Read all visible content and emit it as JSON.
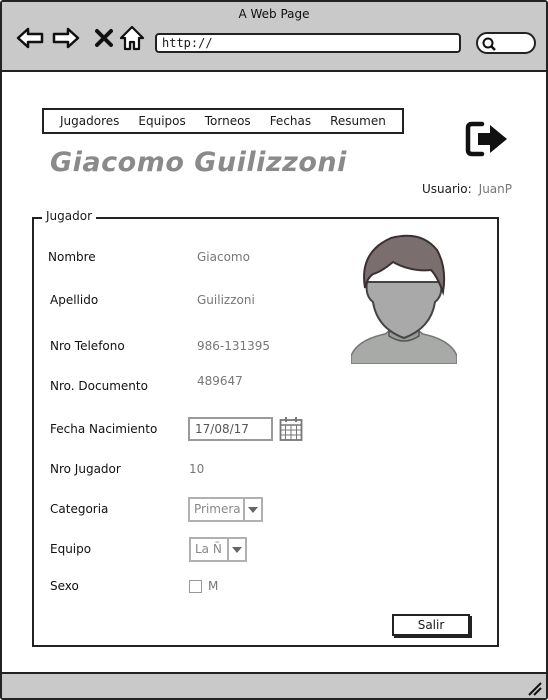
{
  "window": {
    "title": "A Web Page",
    "url": "http://"
  },
  "menu": {
    "items": [
      "Jugadores",
      "Equipos",
      "Torneos",
      "Fechas",
      "Resumen"
    ]
  },
  "header": {
    "title": "Giacomo Guilizzoni",
    "user_label": "Usuario:",
    "user_value": "JuanP"
  },
  "form": {
    "legend": "Jugador",
    "nombre_label": "Nombre",
    "nombre_value": "Giacomo",
    "apellido_label": "Apellido",
    "apellido_value": "Guilizzoni",
    "telefono_label": "Nro Telefono",
    "telefono_value": "986-131395",
    "documento_label": "Nro. Documento",
    "documento_value": "489647",
    "fecha_label": "Fecha Nacimiento",
    "fecha_value": "17/08/17",
    "jugador_label": "Nro Jugador",
    "jugador_value": "10",
    "categoria_label": "Categoria",
    "categoria_value": "Primera",
    "equipo_label": "Equipo",
    "equipo_value": "La Ñ",
    "sexo_label": "Sexo",
    "sexo_option": "M",
    "sexo_checked": false,
    "salir_label": "Salir"
  },
  "icons": {
    "back": "back-arrow-icon",
    "forward": "forward-arrow-icon",
    "close": "close-icon",
    "home": "home-icon",
    "search": "search-icon",
    "logout": "logout-icon",
    "calendar": "calendar-icon",
    "avatar": "user-avatar-icon",
    "dropdown": "chevron-down-icon"
  },
  "colors": {
    "chrome": "#c9c9c9",
    "title_text": "#8a8a8a",
    "value_text": "#777777"
  }
}
